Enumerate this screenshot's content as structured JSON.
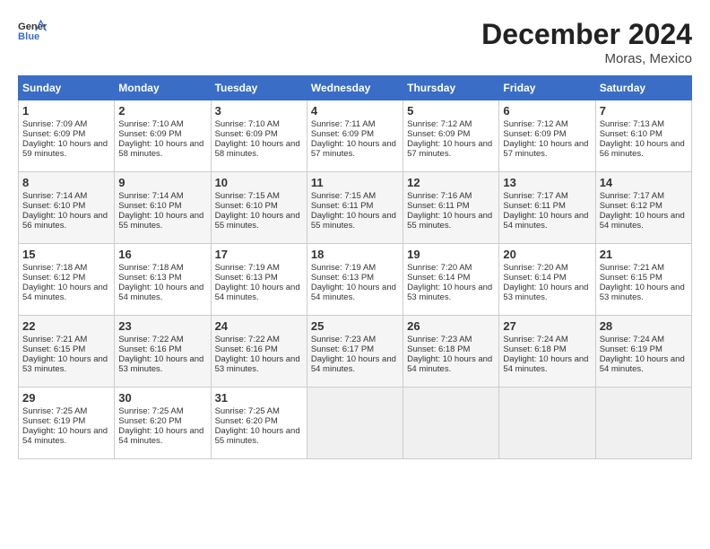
{
  "header": {
    "logo_line1": "General",
    "logo_line2": "Blue",
    "month": "December 2024",
    "location": "Moras, Mexico"
  },
  "days_of_week": [
    "Sunday",
    "Monday",
    "Tuesday",
    "Wednesday",
    "Thursday",
    "Friday",
    "Saturday"
  ],
  "weeks": [
    [
      {
        "day": 1,
        "sunrise": "7:09 AM",
        "sunset": "6:09 PM",
        "daylight": "10 hours and 59 minutes."
      },
      {
        "day": 2,
        "sunrise": "7:10 AM",
        "sunset": "6:09 PM",
        "daylight": "10 hours and 58 minutes."
      },
      {
        "day": 3,
        "sunrise": "7:10 AM",
        "sunset": "6:09 PM",
        "daylight": "10 hours and 58 minutes."
      },
      {
        "day": 4,
        "sunrise": "7:11 AM",
        "sunset": "6:09 PM",
        "daylight": "10 hours and 57 minutes."
      },
      {
        "day": 5,
        "sunrise": "7:12 AM",
        "sunset": "6:09 PM",
        "daylight": "10 hours and 57 minutes."
      },
      {
        "day": 6,
        "sunrise": "7:12 AM",
        "sunset": "6:09 PM",
        "daylight": "10 hours and 57 minutes."
      },
      {
        "day": 7,
        "sunrise": "7:13 AM",
        "sunset": "6:10 PM",
        "daylight": "10 hours and 56 minutes."
      }
    ],
    [
      {
        "day": 8,
        "sunrise": "7:14 AM",
        "sunset": "6:10 PM",
        "daylight": "10 hours and 56 minutes."
      },
      {
        "day": 9,
        "sunrise": "7:14 AM",
        "sunset": "6:10 PM",
        "daylight": "10 hours and 55 minutes."
      },
      {
        "day": 10,
        "sunrise": "7:15 AM",
        "sunset": "6:10 PM",
        "daylight": "10 hours and 55 minutes."
      },
      {
        "day": 11,
        "sunrise": "7:15 AM",
        "sunset": "6:11 PM",
        "daylight": "10 hours and 55 minutes."
      },
      {
        "day": 12,
        "sunrise": "7:16 AM",
        "sunset": "6:11 PM",
        "daylight": "10 hours and 55 minutes."
      },
      {
        "day": 13,
        "sunrise": "7:17 AM",
        "sunset": "6:11 PM",
        "daylight": "10 hours and 54 minutes."
      },
      {
        "day": 14,
        "sunrise": "7:17 AM",
        "sunset": "6:12 PM",
        "daylight": "10 hours and 54 minutes."
      }
    ],
    [
      {
        "day": 15,
        "sunrise": "7:18 AM",
        "sunset": "6:12 PM",
        "daylight": "10 hours and 54 minutes."
      },
      {
        "day": 16,
        "sunrise": "7:18 AM",
        "sunset": "6:13 PM",
        "daylight": "10 hours and 54 minutes."
      },
      {
        "day": 17,
        "sunrise": "7:19 AM",
        "sunset": "6:13 PM",
        "daylight": "10 hours and 54 minutes."
      },
      {
        "day": 18,
        "sunrise": "7:19 AM",
        "sunset": "6:13 PM",
        "daylight": "10 hours and 54 minutes."
      },
      {
        "day": 19,
        "sunrise": "7:20 AM",
        "sunset": "6:14 PM",
        "daylight": "10 hours and 53 minutes."
      },
      {
        "day": 20,
        "sunrise": "7:20 AM",
        "sunset": "6:14 PM",
        "daylight": "10 hours and 53 minutes."
      },
      {
        "day": 21,
        "sunrise": "7:21 AM",
        "sunset": "6:15 PM",
        "daylight": "10 hours and 53 minutes."
      }
    ],
    [
      {
        "day": 22,
        "sunrise": "7:21 AM",
        "sunset": "6:15 PM",
        "daylight": "10 hours and 53 minutes."
      },
      {
        "day": 23,
        "sunrise": "7:22 AM",
        "sunset": "6:16 PM",
        "daylight": "10 hours and 53 minutes."
      },
      {
        "day": 24,
        "sunrise": "7:22 AM",
        "sunset": "6:16 PM",
        "daylight": "10 hours and 53 minutes."
      },
      {
        "day": 25,
        "sunrise": "7:23 AM",
        "sunset": "6:17 PM",
        "daylight": "10 hours and 54 minutes."
      },
      {
        "day": 26,
        "sunrise": "7:23 AM",
        "sunset": "6:18 PM",
        "daylight": "10 hours and 54 minutes."
      },
      {
        "day": 27,
        "sunrise": "7:24 AM",
        "sunset": "6:18 PM",
        "daylight": "10 hours and 54 minutes."
      },
      {
        "day": 28,
        "sunrise": "7:24 AM",
        "sunset": "6:19 PM",
        "daylight": "10 hours and 54 minutes."
      }
    ],
    [
      {
        "day": 29,
        "sunrise": "7:25 AM",
        "sunset": "6:19 PM",
        "daylight": "10 hours and 54 minutes."
      },
      {
        "day": 30,
        "sunrise": "7:25 AM",
        "sunset": "6:20 PM",
        "daylight": "10 hours and 54 minutes."
      },
      {
        "day": 31,
        "sunrise": "7:25 AM",
        "sunset": "6:20 PM",
        "daylight": "10 hours and 55 minutes."
      },
      null,
      null,
      null,
      null
    ]
  ]
}
